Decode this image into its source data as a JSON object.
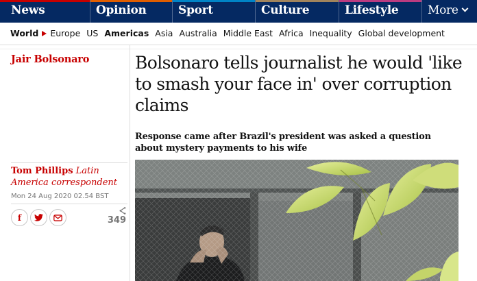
{
  "top_nav": {
    "pillars": [
      {
        "label": "News",
        "accent": "#c70000"
      },
      {
        "label": "Opinion",
        "accent": "#e05e00"
      },
      {
        "label": "Sport",
        "accent": "#0084c6"
      },
      {
        "label": "Culture",
        "accent": "#a1845c"
      },
      {
        "label": "Lifestyle",
        "accent": "#bb3b80"
      }
    ],
    "more_label": "More",
    "background": "#052962"
  },
  "sub_nav": {
    "items": [
      "World",
      "Europe",
      "US",
      "Americas",
      "Asia",
      "Australia",
      "Middle East",
      "Africa",
      "Inequality",
      "Global development"
    ]
  },
  "article": {
    "series": "Jair Bolsonaro",
    "headline": "Bolsonaro tells journalist he would 'like to smash your face in' over corruption claims",
    "standfirst": "Response came after Brazil's president was asked a question about mystery payments to his wife",
    "author": "Tom Phillips",
    "author_role": "Latin America correspondent",
    "date": "Mon 24 Aug 2020 02.54 BST",
    "share_count": "349"
  },
  "share_buttons": [
    {
      "icon": "facebook-icon",
      "glyph": "f"
    },
    {
      "icon": "twitter-icon",
      "glyph": "t"
    },
    {
      "icon": "email-icon",
      "glyph": "✉"
    }
  ],
  "colors": {
    "brand_navy": "#052962",
    "news_red": "#c70000"
  }
}
